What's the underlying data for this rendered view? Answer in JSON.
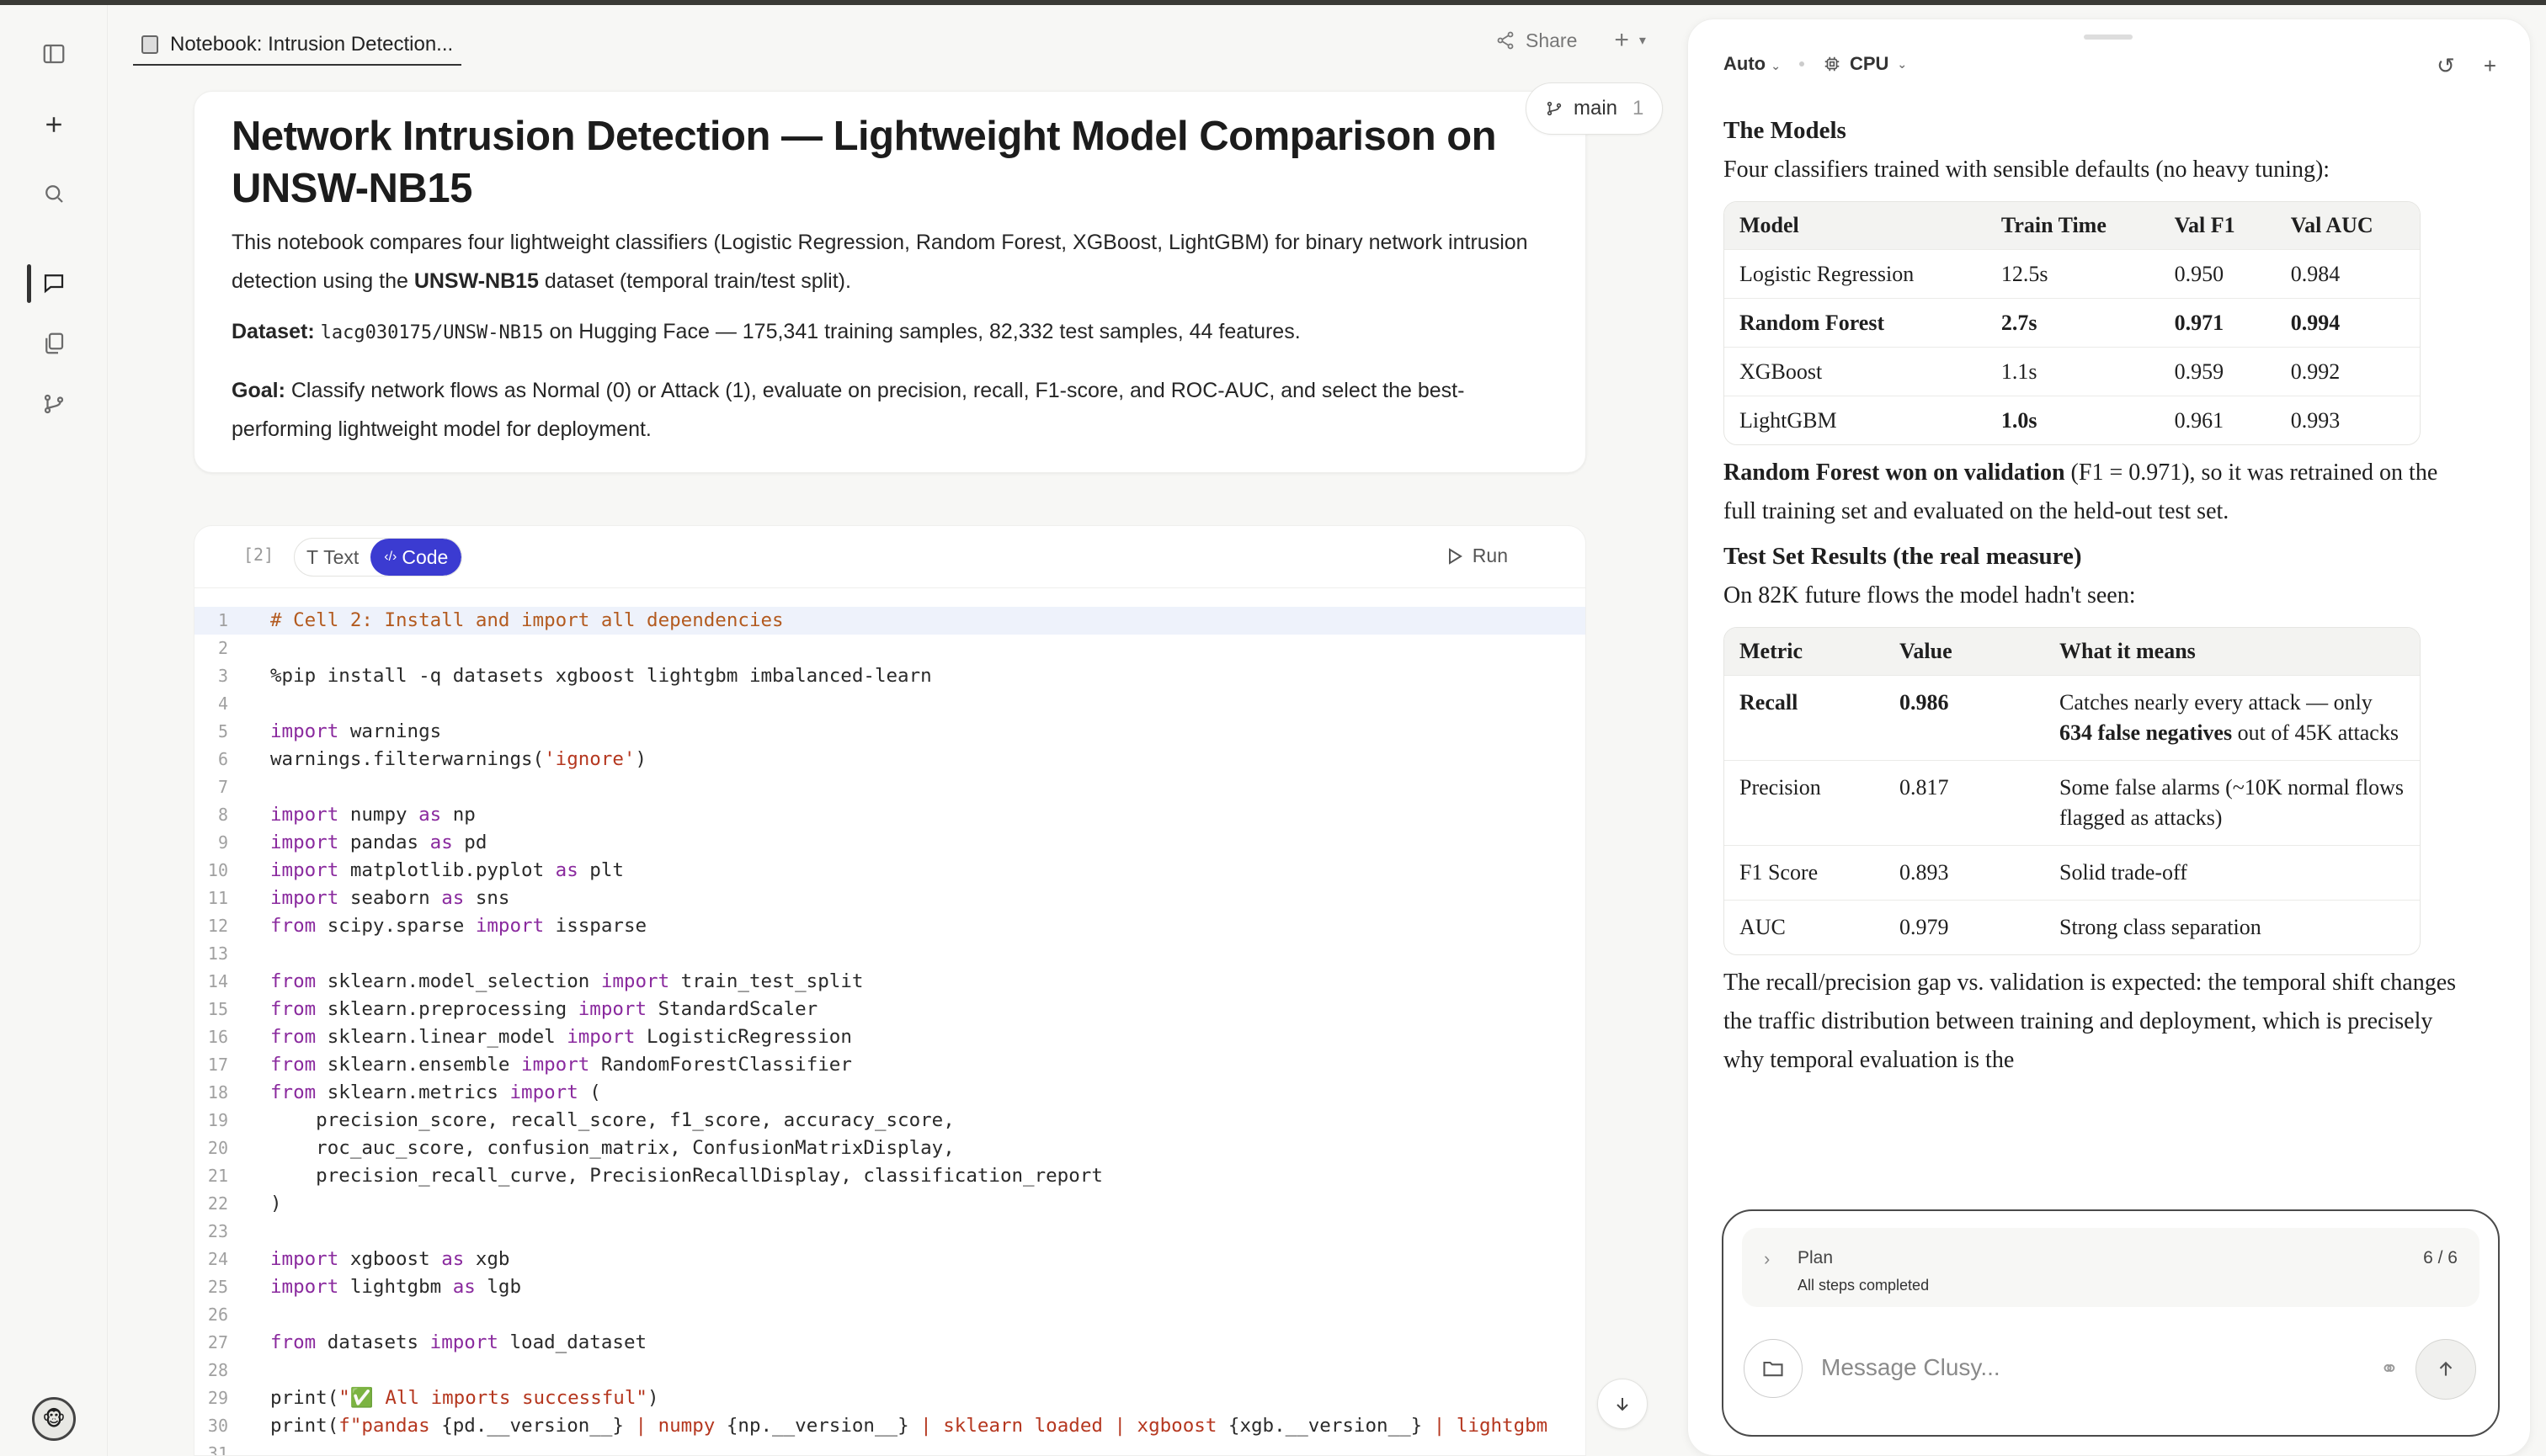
{
  "tab": {
    "title": "Notebook: Intrusion Detection..."
  },
  "header": {
    "share_label": "Share",
    "add_label": "+"
  },
  "branch": {
    "name": "main",
    "count": "1"
  },
  "title_cell": {
    "title": "Network Intrusion Detection — Lightweight Model Comparison on UNSW-NB15",
    "intro_a": "This notebook compares four lightweight classifiers (Logistic Regression, Random Forest, XGBoost, LightGBM) for binary network intrusion detection using the ",
    "intro_bold": "UNSW-NB15",
    "intro_b": " dataset (temporal train/test split).",
    "dataset_label": "Dataset:",
    "dataset_id": "lacg030175/UNSW-NB15",
    "dataset_rest": " on Hugging Face — 175,341 training samples, 82,332 test samples, 44 features.",
    "goal_label": "Goal:",
    "goal_text": " Classify network flows as Normal (0) or Attack (1), evaluate on precision, recall, F1-score, and ROC-AUC, and select the best-performing lightweight model for deployment."
  },
  "code_cell": {
    "exec_count": "[2]",
    "text_label": "Text",
    "code_label": "Code",
    "run_label": "Run",
    "lines": [
      [
        [
          "cm",
          "# Cell 2: Install and import all dependencies"
        ]
      ],
      [],
      [
        [
          "fn",
          "%pip install -q datasets xgboost lightgbm imbalanced-learn"
        ]
      ],
      [],
      [
        [
          "kw",
          "import"
        ],
        [
          "fn",
          " warnings"
        ]
      ],
      [
        [
          "fn",
          "warnings.filterwarnings("
        ],
        [
          "st",
          "'ignore'"
        ],
        [
          "fn",
          ")"
        ]
      ],
      [],
      [
        [
          "kw",
          "import"
        ],
        [
          "fn",
          " numpy "
        ],
        [
          "kw",
          "as"
        ],
        [
          "fn",
          " np"
        ]
      ],
      [
        [
          "kw",
          "import"
        ],
        [
          "fn",
          " pandas "
        ],
        [
          "kw",
          "as"
        ],
        [
          "fn",
          " pd"
        ]
      ],
      [
        [
          "kw",
          "import"
        ],
        [
          "fn",
          " matplotlib.pyplot "
        ],
        [
          "kw",
          "as"
        ],
        [
          "fn",
          " plt"
        ]
      ],
      [
        [
          "kw",
          "import"
        ],
        [
          "fn",
          " seaborn "
        ],
        [
          "kw",
          "as"
        ],
        [
          "fn",
          " sns"
        ]
      ],
      [
        [
          "kw",
          "from"
        ],
        [
          "fn",
          " scipy.sparse "
        ],
        [
          "kw",
          "import"
        ],
        [
          "fn",
          " issparse"
        ]
      ],
      [],
      [
        [
          "kw",
          "from"
        ],
        [
          "fn",
          " sklearn.model_selection "
        ],
        [
          "kw",
          "import"
        ],
        [
          "fn",
          " train_test_split"
        ]
      ],
      [
        [
          "kw",
          "from"
        ],
        [
          "fn",
          " sklearn.preprocessing "
        ],
        [
          "kw",
          "import"
        ],
        [
          "fn",
          " StandardScaler"
        ]
      ],
      [
        [
          "kw",
          "from"
        ],
        [
          "fn",
          " sklearn.linear_model "
        ],
        [
          "kw",
          "import"
        ],
        [
          "fn",
          " LogisticRegression"
        ]
      ],
      [
        [
          "kw",
          "from"
        ],
        [
          "fn",
          " sklearn.ensemble "
        ],
        [
          "kw",
          "import"
        ],
        [
          "fn",
          " RandomForestClassifier"
        ]
      ],
      [
        [
          "kw",
          "from"
        ],
        [
          "fn",
          " sklearn.metrics "
        ],
        [
          "kw",
          "import"
        ],
        [
          "fn",
          " ("
        ]
      ],
      [
        [
          "fn",
          "    precision_score, recall_score, f1_score, accuracy_score,"
        ]
      ],
      [
        [
          "fn",
          "    roc_auc_score, confusion_matrix, ConfusionMatrixDisplay,"
        ]
      ],
      [
        [
          "fn",
          "    precision_recall_curve, PrecisionRecallDisplay, classification_report"
        ]
      ],
      [
        [
          "fn",
          ")"
        ]
      ],
      [],
      [
        [
          "kw",
          "import"
        ],
        [
          "fn",
          " xgboost "
        ],
        [
          "kw",
          "as"
        ],
        [
          "fn",
          " xgb"
        ]
      ],
      [
        [
          "kw",
          "import"
        ],
        [
          "fn",
          " lightgbm "
        ],
        [
          "kw",
          "as"
        ],
        [
          "fn",
          " lgb"
        ]
      ],
      [],
      [
        [
          "kw",
          "from"
        ],
        [
          "fn",
          " datasets "
        ],
        [
          "kw",
          "import"
        ],
        [
          "fn",
          " load_dataset"
        ]
      ],
      [],
      [
        [
          "fn",
          "print("
        ],
        [
          "st",
          "\"✅ All imports successful\""
        ],
        [
          "fn",
          ")"
        ]
      ],
      [
        [
          "fn",
          "print("
        ],
        [
          "st",
          "f\"pandas "
        ],
        [
          "fn",
          "{pd.__version__}"
        ],
        [
          "st",
          " | numpy "
        ],
        [
          "fn",
          "{np.__version__}"
        ],
        [
          "st",
          " | sklearn loaded | xgboost "
        ],
        [
          "fn",
          "{xgb.__version__}"
        ],
        [
          "st",
          " | lightgbm"
        ]
      ],
      []
    ]
  },
  "panel": {
    "mode_label": "Auto",
    "device_label": "CPU",
    "models_heading": "The Models",
    "models_intro": "Four classifiers trained with sensible defaults (no heavy tuning):",
    "models_table": {
      "headers": [
        "Model",
        "Train Time",
        "Val F1",
        "Val AUC"
      ],
      "rows": [
        [
          "Logistic Regression",
          "12.5s",
          "0.950",
          "0.984"
        ],
        [
          "Random Forest",
          "2.7s",
          "0.971",
          "0.994"
        ],
        [
          "XGBoost",
          "1.1s",
          "0.959",
          "0.992"
        ],
        [
          "LightGBM",
          "1.0s",
          "0.961",
          "0.993"
        ]
      ]
    },
    "winner_bold": "Random Forest won on validation",
    "winner_rest": " (F1 = 0.971), so it was retrained on the full training set and evaluated on the held-out test set.",
    "test_heading": "Test Set Results (the real measure)",
    "test_intro": "On 82K future flows the model hadn't seen:",
    "test_table": {
      "headers": [
        "Metric",
        "Value",
        "What it means"
      ],
      "rows": [
        {
          "metric": "Recall",
          "value": "0.986",
          "meaning_a": "Catches nearly every attack — only ",
          "meaning_bold": "634 false negatives",
          "meaning_b": " out of 45K attacks"
        },
        {
          "metric": "Precision",
          "value": "0.817",
          "meaning_a": "Some false alarms (~10K normal flows flagged as attacks)",
          "meaning_bold": "",
          "meaning_b": ""
        },
        {
          "metric": "F1 Score",
          "value": "0.893",
          "meaning_a": "Solid trade-off",
          "meaning_bold": "",
          "meaning_b": ""
        },
        {
          "metric": "AUC",
          "value": "0.979",
          "meaning_a": "Strong class separation",
          "meaning_bold": "",
          "meaning_b": ""
        }
      ]
    },
    "closing": "The recall/precision gap vs. validation is expected: the temporal shift changes the traffic distribution between training and deployment, which is precisely why temporal evaluation is the"
  },
  "composer": {
    "plan_label": "Plan",
    "plan_status": "All steps completed",
    "plan_count": "6 / 6",
    "placeholder": "Message Clusy..."
  }
}
